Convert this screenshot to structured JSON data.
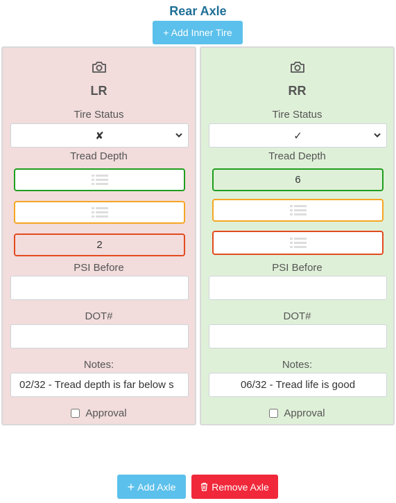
{
  "axle": {
    "title": "Rear Axle",
    "add_inner_tire_label": "+ Add Inner Tire"
  },
  "labels": {
    "tire_status": "Tire Status",
    "tread_depth": "Tread Depth",
    "psi_before": "PSI Before",
    "dot": "DOT#",
    "notes": "Notes:",
    "approval": "Approval"
  },
  "tires": [
    {
      "position": "LR",
      "status": "✘",
      "status_color": "#f2dcdc",
      "tread_green": "",
      "tread_orange": "",
      "tread_red": "2",
      "psi_before": "",
      "dot": "",
      "notes": "02/32 - Tread depth is far below s",
      "approval_checked": false
    },
    {
      "position": "RR",
      "status": "✓",
      "status_color": "#dff0d8",
      "tread_green": "6",
      "tread_orange": "",
      "tread_red": "",
      "psi_before": "",
      "dot": "",
      "notes": "06/32 - Tread life is good",
      "approval_checked": false
    }
  ],
  "footer": {
    "add_axle_label": "Add Axle",
    "remove_axle_label": "Remove Axle"
  },
  "colors": {
    "title": "#1f6f97",
    "info": "#5bc0eb",
    "danger": "#f0283a",
    "tread_good": "#1e9f1e",
    "tread_warn": "#f5a623",
    "tread_bad": "#e34a1e"
  }
}
